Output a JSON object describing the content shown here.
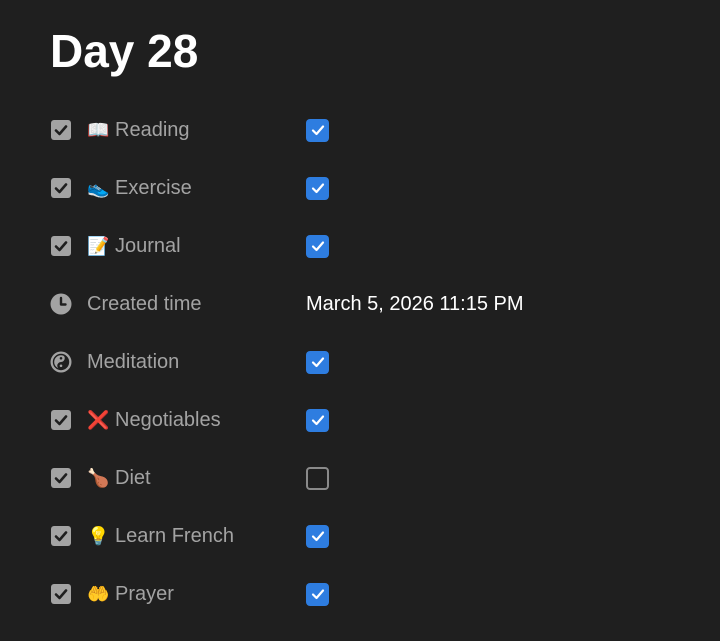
{
  "page": {
    "title": "Day 28"
  },
  "properties": [
    {
      "type": "checkbox",
      "icon": "checkbox-icon",
      "emoji": "📖",
      "emoji_name": "open-book-emoji",
      "label": "Reading",
      "checked": true
    },
    {
      "type": "checkbox",
      "icon": "checkbox-icon",
      "emoji": "👟",
      "emoji_name": "shoe-emoji",
      "label": "Exercise",
      "checked": true
    },
    {
      "type": "checkbox",
      "icon": "checkbox-icon",
      "emoji": "📝",
      "emoji_name": "memo-emoji",
      "label": "Journal",
      "checked": true
    },
    {
      "type": "created_time",
      "icon": "clock-icon",
      "emoji": "",
      "label": "Created time",
      "value": "March 5, 2026 11:15 PM"
    },
    {
      "type": "formula",
      "icon": "yin-yang-icon",
      "emoji": "",
      "label": "Meditation",
      "checked": true
    },
    {
      "type": "checkbox",
      "icon": "checkbox-icon",
      "emoji": "❌",
      "emoji_name": "cross-mark-emoji",
      "label": "Negotiables",
      "checked": true
    },
    {
      "type": "checkbox",
      "icon": "checkbox-icon",
      "emoji": "🍗",
      "emoji_name": "poultry-leg-emoji",
      "label": "Diet",
      "checked": false
    },
    {
      "type": "checkbox",
      "icon": "checkbox-icon",
      "emoji": "💡",
      "emoji_name": "light-bulb-emoji",
      "label": "Learn French",
      "checked": true
    },
    {
      "type": "checkbox",
      "icon": "checkbox-icon",
      "emoji": "🤲",
      "emoji_name": "palms-up-emoji",
      "label": "Prayer",
      "checked": true
    }
  ],
  "colors": {
    "background": "#1f1f1f",
    "checkbox_checked": "#2e7de0",
    "label": "#a3a3a3",
    "value": "#ffffff"
  }
}
